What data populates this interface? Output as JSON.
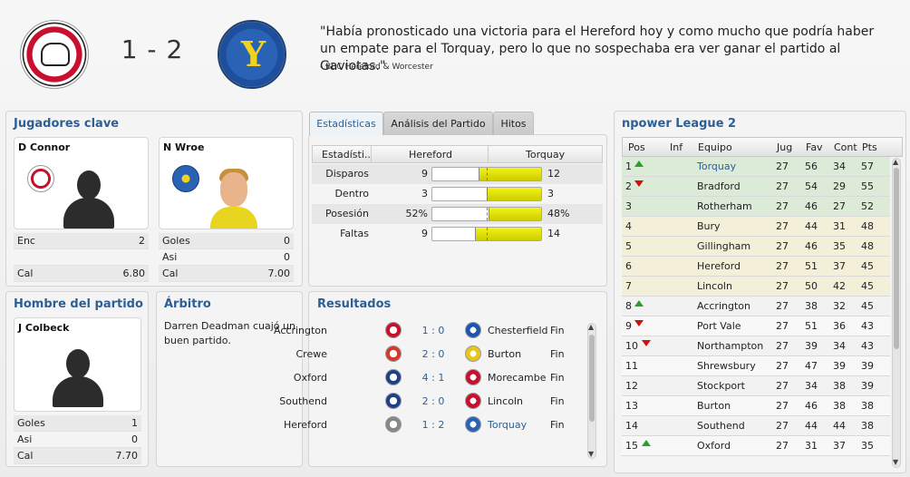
{
  "header": {
    "home_crest": "hereford-crest",
    "away_crest": "torquay-crest",
    "score": "1 - 2",
    "quote": "\"Había pronosticado una victoria para el Hereford hoy y como mucho que podría haber un empate para el Torquay, pero lo que no sospechaba era ver ganar el partido al Gaviotas.\"",
    "quote_source": "- BBC Hereford & Worcester"
  },
  "key_players": {
    "title": "Jugadores clave",
    "home": {
      "name": "D Connor",
      "stats": [
        {
          "label": "Enc",
          "value": "2"
        },
        {
          "label": "",
          "value": ""
        },
        {
          "label": "Cal",
          "value": "6.80"
        }
      ]
    },
    "away": {
      "name": "N Wroe",
      "stats": [
        {
          "label": "Goles",
          "value": "0"
        },
        {
          "label": "Asi",
          "value": "0"
        },
        {
          "label": "Cal",
          "value": "7.00"
        }
      ]
    }
  },
  "motm": {
    "title": "Hombre del partido",
    "name": "J Colbeck",
    "stats": [
      {
        "label": "Goles",
        "value": "1"
      },
      {
        "label": "Asi",
        "value": "0"
      },
      {
        "label": "Cal",
        "value": "7.70"
      }
    ]
  },
  "referee": {
    "title": "Árbitro",
    "text": "Darren Deadman cuajó un buen partido."
  },
  "tabs": [
    "Estadísticas",
    "Análisis del Partido",
    "Hitos"
  ],
  "stats": {
    "headers": [
      "Estadísti..",
      "Hereford",
      "Torquay"
    ],
    "rows": [
      {
        "label": "Disparos",
        "home": "9",
        "away": "12",
        "away_share": 0.571
      },
      {
        "label": "Dentro",
        "home": "3",
        "away": "3",
        "away_share": 0.5
      },
      {
        "label": "Posesión",
        "home": "52%",
        "away": "48%",
        "away_share": 0.48
      },
      {
        "label": "Faltas",
        "home": "9",
        "away": "14",
        "away_share": 0.609
      }
    ]
  },
  "results": {
    "title": "Resultados",
    "rows": [
      {
        "home": "Accrington",
        "score": "1 : 0",
        "away": "Chesterfield",
        "status": "Fin",
        "away_highlight": false
      },
      {
        "home": "Crewe",
        "score": "2 : 0",
        "away": "Burton",
        "status": "Fin",
        "away_highlight": false
      },
      {
        "home": "Oxford",
        "score": "4 : 1",
        "away": "Morecambe",
        "status": "Fin",
        "away_highlight": false
      },
      {
        "home": "Southend",
        "score": "2 : 0",
        "away": "Lincoln",
        "status": "Fin",
        "away_highlight": false
      },
      {
        "home": "Hereford",
        "score": "1 : 2",
        "away": "Torquay",
        "status": "Fin",
        "away_highlight": true
      }
    ]
  },
  "league": {
    "title": "npower League 2",
    "headers": [
      "Pos",
      "Inf",
      "Equipo",
      "Jug",
      "Fav",
      "Cont",
      "Pts"
    ],
    "rows": [
      {
        "pos": "1",
        "trend": "up",
        "team": "Torquay",
        "jug": "27",
        "fav": "56",
        "cont": "34",
        "pts": "57",
        "zone": "green",
        "highlight": true
      },
      {
        "pos": "2",
        "trend": "down",
        "team": "Bradford",
        "jug": "27",
        "fav": "54",
        "cont": "29",
        "pts": "55",
        "zone": "green",
        "highlight": false
      },
      {
        "pos": "3",
        "trend": "",
        "team": "Rotherham",
        "jug": "27",
        "fav": "46",
        "cont": "27",
        "pts": "52",
        "zone": "green",
        "highlight": false
      },
      {
        "pos": "4",
        "trend": "",
        "team": "Bury",
        "jug": "27",
        "fav": "44",
        "cont": "31",
        "pts": "48",
        "zone": "yellow",
        "highlight": false
      },
      {
        "pos": "5",
        "trend": "",
        "team": "Gillingham",
        "jug": "27",
        "fav": "46",
        "cont": "35",
        "pts": "48",
        "zone": "yellow",
        "highlight": false
      },
      {
        "pos": "6",
        "trend": "",
        "team": "Hereford",
        "jug": "27",
        "fav": "51",
        "cont": "37",
        "pts": "45",
        "zone": "yellow",
        "highlight": false
      },
      {
        "pos": "7",
        "trend": "",
        "team": "Lincoln",
        "jug": "27",
        "fav": "50",
        "cont": "42",
        "pts": "45",
        "zone": "yellow",
        "highlight": false
      },
      {
        "pos": "8",
        "trend": "up",
        "team": "Accrington",
        "jug": "27",
        "fav": "38",
        "cont": "32",
        "pts": "45",
        "zone": "none",
        "highlight": false
      },
      {
        "pos": "9",
        "trend": "down",
        "team": "Port Vale",
        "jug": "27",
        "fav": "51",
        "cont": "36",
        "pts": "43",
        "zone": "none",
        "highlight": false
      },
      {
        "pos": "10",
        "trend": "down",
        "team": "Northampton",
        "jug": "27",
        "fav": "39",
        "cont": "34",
        "pts": "43",
        "zone": "none",
        "highlight": false
      },
      {
        "pos": "11",
        "trend": "",
        "team": "Shrewsbury",
        "jug": "27",
        "fav": "47",
        "cont": "39",
        "pts": "39",
        "zone": "none",
        "highlight": false
      },
      {
        "pos": "12",
        "trend": "",
        "team": "Stockport",
        "jug": "27",
        "fav": "34",
        "cont": "38",
        "pts": "39",
        "zone": "none",
        "highlight": false
      },
      {
        "pos": "13",
        "trend": "",
        "team": "Burton",
        "jug": "27",
        "fav": "46",
        "cont": "38",
        "pts": "38",
        "zone": "none",
        "highlight": false
      },
      {
        "pos": "14",
        "trend": "",
        "team": "Southend",
        "jug": "27",
        "fav": "44",
        "cont": "44",
        "pts": "38",
        "zone": "none",
        "highlight": false
      },
      {
        "pos": "15",
        "trend": "up",
        "team": "Oxford",
        "jug": "27",
        "fav": "31",
        "cont": "37",
        "pts": "35",
        "zone": "none",
        "highlight": false
      }
    ]
  },
  "colors": {
    "accent": "#2d5f94",
    "zone_green": "#dcebd8",
    "zone_yellow": "#f3efd9",
    "bar_fill": "#e6e600"
  }
}
